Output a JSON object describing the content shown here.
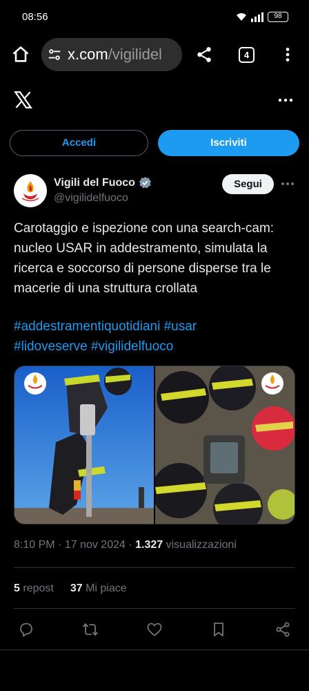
{
  "status_bar": {
    "time": "08:56",
    "battery": "98"
  },
  "browser": {
    "url_host": "x.com",
    "url_path": "/vigilidel",
    "tab_count": "4"
  },
  "auth": {
    "login_label": "Accedi",
    "signup_label": "Iscriviti"
  },
  "tweet": {
    "author_name": "Vigili del Fuoco",
    "author_handle": "@vigilidelfuoco",
    "follow_label": "Segui",
    "text": "Carotaggio e ispezione con una search-cam: nucleo USAR in addestramento, simulata la ricerca e soccorso di persone disperse tra le macerie di una struttura crollata",
    "hashtags": [
      "#addestramentiquotidiani",
      "#usar",
      "#lidoveserve",
      "#vigilidelfuoco"
    ],
    "time": "8:10 PM",
    "date": "17 nov 2024",
    "views_count": "1.327",
    "views_label": "visualizzazioni",
    "reposts_count": "5",
    "reposts_label": "repost",
    "likes_count": "37",
    "likes_label": "Mi piace"
  },
  "colors": {
    "accent": "#1d9bf0",
    "background": "#000000",
    "muted": "#71767b"
  },
  "icons": [
    "home-icon",
    "tune-icon",
    "share-icon",
    "more-vert-icon",
    "x-logo",
    "more-horiz-icon",
    "verified-badge-icon",
    "reply-icon",
    "repost-icon",
    "like-icon",
    "bookmark-icon",
    "share-tweet-icon"
  ]
}
